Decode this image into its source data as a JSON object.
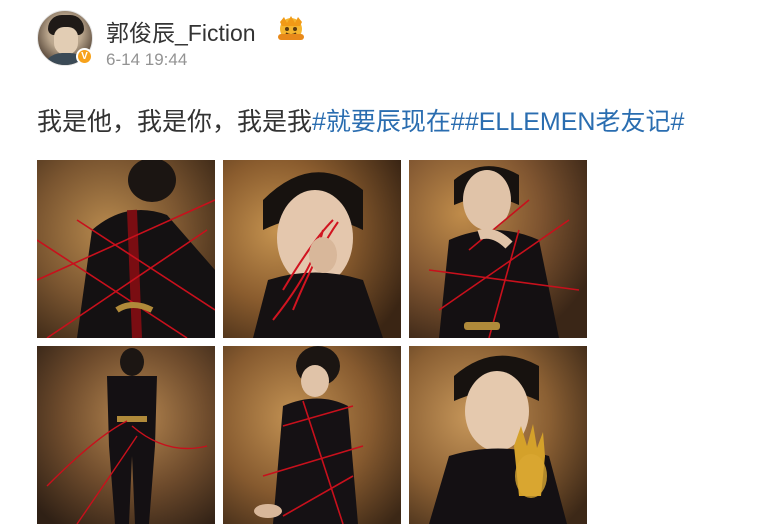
{
  "author": {
    "name": "郭俊辰_Fiction",
    "verified_badge": "V",
    "badge_icon": "crown-icon",
    "timestamp": "6-14 19:44"
  },
  "post": {
    "text_plain": "我是他，我是你，我是我",
    "hashtags": [
      "#就要辰现在#",
      "#ELLEMEN老友记#"
    ]
  },
  "colors": {
    "link": "#2a6db0",
    "text": "#333333",
    "meta": "#939393",
    "verify": "#f7a21b"
  },
  "photos": [
    {
      "id": "photo-1"
    },
    {
      "id": "photo-2"
    },
    {
      "id": "photo-3"
    },
    {
      "id": "photo-4"
    },
    {
      "id": "photo-5"
    },
    {
      "id": "photo-6"
    }
  ]
}
